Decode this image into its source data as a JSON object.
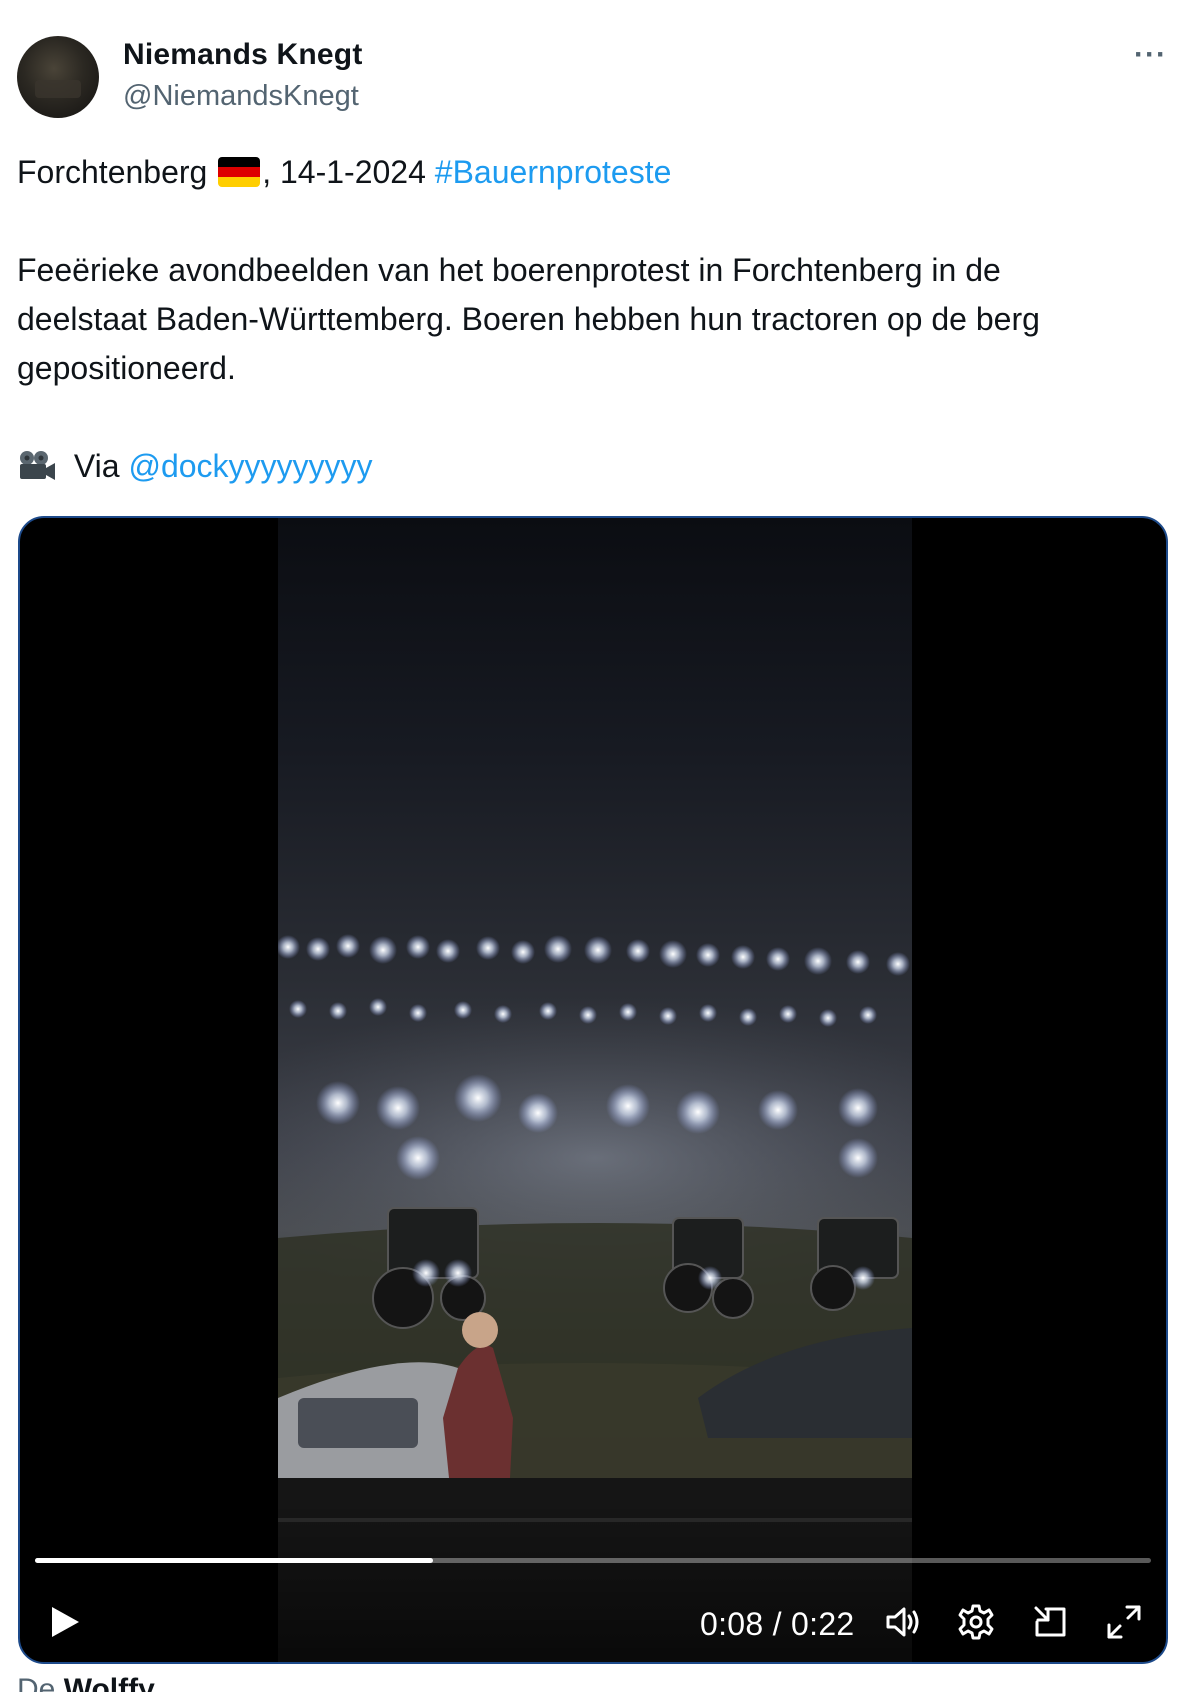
{
  "author": {
    "display_name": "Niemands Knegt",
    "handle": "@NiemandsKnegt",
    "avatar_icon": "profile-avatar"
  },
  "more_icon": "more-horizontal-icon",
  "tweet": {
    "line1_place": "Forchtenberg",
    "line1_flag": "germany-flag-emoji",
    "line1_date": ", 14-1-2024 ",
    "line1_hashtag": "#Bauernproteste",
    "body_lines": [
      "Feeërieke avondbeelden van het boerenprotest in Forchtenberg in de",
      "deelstaat Baden-Württemberg. Boeren hebben hun tractoren op de berg",
      "gepositioneerd."
    ],
    "via_icon": "film-projector-emoji",
    "via_label": " Via ",
    "via_mention": "@dockyyyyyyyyy"
  },
  "video": {
    "time": "0:08 / 0:22",
    "progress": 0.357,
    "play_icon": "play-icon",
    "volume_icon": "volume-icon",
    "settings_icon": "gear-icon",
    "pip_icon": "picture-in-picture-icon",
    "fullscreen_icon": "fullscreen-icon"
  },
  "next_item": {
    "prefix": "De ",
    "name": "Wolffy"
  },
  "colors": {
    "link": "#1d9bf0",
    "secondary_text": "#536471",
    "primary_text": "#0f1419"
  }
}
